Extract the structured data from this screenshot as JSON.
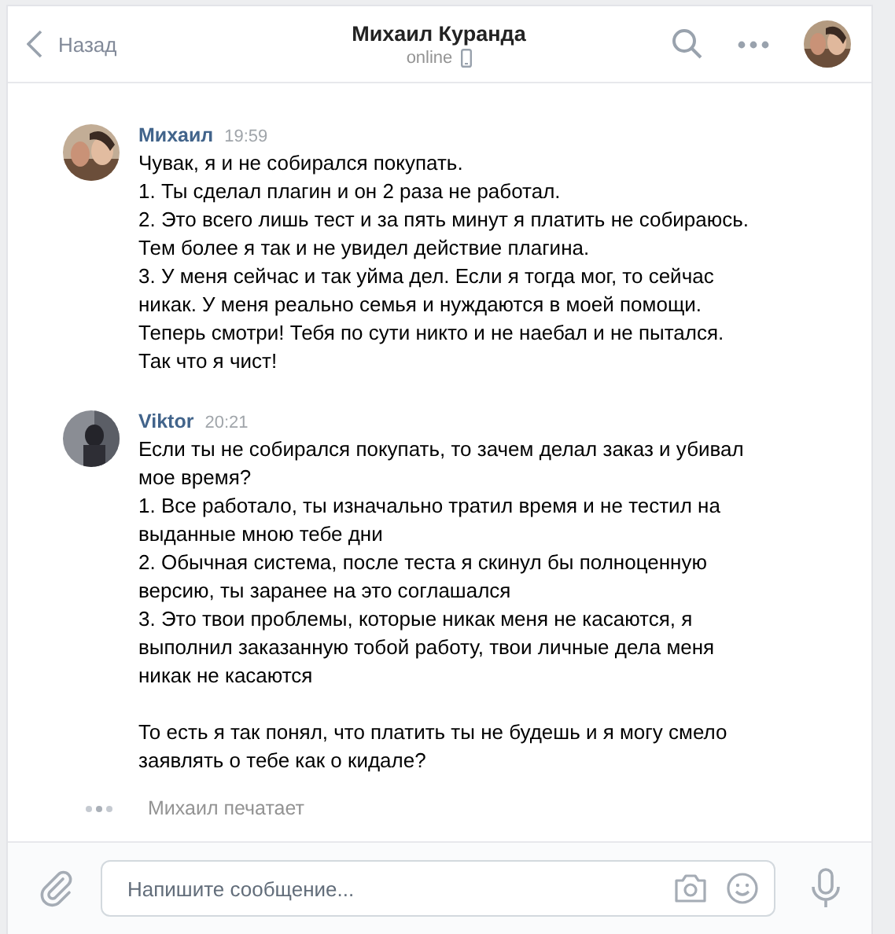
{
  "header": {
    "back": "Назад",
    "title": "Михаил Куранда",
    "status": "online"
  },
  "messages": [
    {
      "author": "Михаил",
      "time": "19:59",
      "avatar": {
        "kind": "picture"
      },
      "paragraphs": [
        [
          "Чувак, я и не собирался покупать.",
          "1. Ты сделал плагин и он 2 раза не работал.",
          "2. Это всего лишь тест и за пять минут я платить не собираюсь. Тем более я так и не увидел действие плагина.",
          "3. У меня сейчас и так уйма дел. Если я тогда мог, то сейчас никак. У меня реально семья и нуждаются в моей помощи. Теперь смотри! Тебя по сути никто и не наебал и не пытался. Так что я чист!"
        ]
      ]
    },
    {
      "author": "Viktor",
      "time": "20:21",
      "avatar": {
        "kind": "picture"
      },
      "paragraphs": [
        [
          "Если ты не собирался покупать, то зачем делал заказ и убивал мое время?",
          "1. Все работало, ты изначально тратил время и не тестил на выданные мною тебе дни",
          "2. Обычная система, после теста я скинул бы полноценную версию, ты заранее на это соглашался",
          "3. Это твои проблемы, которые никак меня не касаются, я выполнил заказанную тобой работу, твои личные дела меня никак не касаются"
        ],
        [
          "То есть я так понял, что платить ты не будешь и я могу смело заявлять о тебе как о кидале?"
        ]
      ]
    }
  ],
  "typing": "Михаил печатает",
  "composer": {
    "placeholder": "Напишите сообщение..."
  }
}
